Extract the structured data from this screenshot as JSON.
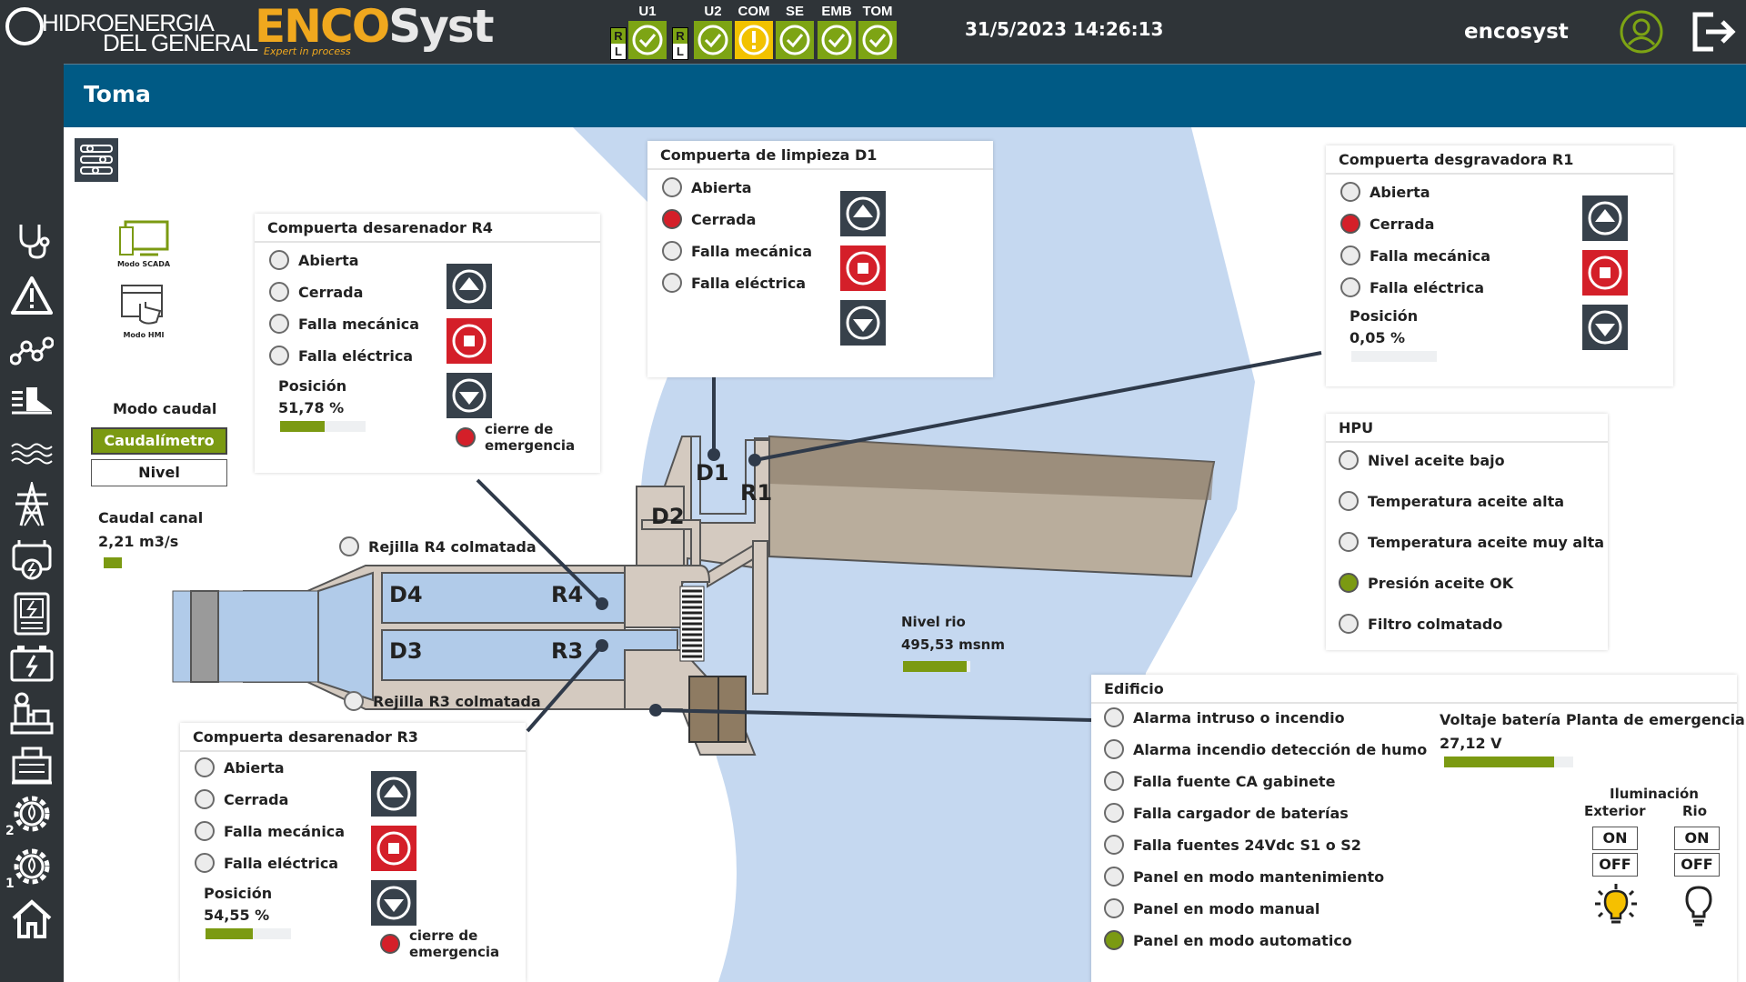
{
  "header": {
    "brand_line1": "HIDROENERGIA",
    "brand_line2": "DEL GENERAL",
    "logo_enco": "ENCO",
    "logo_syst": "Syst",
    "logo_tag": "Expert in process",
    "status": [
      {
        "label": "U1",
        "state": "ok",
        "rl": true
      },
      {
        "label": "U2",
        "state": "ok",
        "rl": true
      },
      {
        "label": "COM",
        "state": "warning",
        "rl": false
      },
      {
        "label": "SE",
        "state": "ok",
        "rl": false
      },
      {
        "label": "EMB",
        "state": "ok",
        "rl": false
      },
      {
        "label": "TOM",
        "state": "ok",
        "rl": false
      }
    ],
    "rl_r": "R",
    "rl_l": "L",
    "datetime": "31/5/2023 14:26:13",
    "username": "encosyst"
  },
  "page_title": "Toma",
  "mode_icons": {
    "scada_label": "Modo SCADA",
    "hmi_label": "Modo HMI"
  },
  "modo_caudal": {
    "title": "Modo caudal",
    "options": [
      "Caudalímetro",
      "Nivel"
    ],
    "active": "Caudalímetro"
  },
  "caudal_canal": {
    "label": "Caudal canal",
    "value": "2,21 m3/s"
  },
  "r4": {
    "title": "Compuerta desarenador R4",
    "states": [
      "Abierta",
      "Cerrada",
      "Falla mecánica",
      "Falla eléctrica"
    ],
    "active_state": "",
    "pos_label": "Posición",
    "pos_value": "51,78 %",
    "pos_fraction": 0.52,
    "emergency_label": "cierre de emergencia"
  },
  "r3": {
    "title": "Compuerta desarenador R3",
    "states": [
      "Abierta",
      "Cerrada",
      "Falla mecánica",
      "Falla eléctrica"
    ],
    "active_state": "",
    "pos_label": "Posición",
    "pos_value": "54,55 %",
    "pos_fraction": 0.55,
    "emergency_label": "cierre de emergencia"
  },
  "d1": {
    "title": "Compuerta de limpieza D1",
    "states": [
      "Abierta",
      "Cerrada",
      "Falla mecánica",
      "Falla eléctrica"
    ],
    "active_state": "Cerrada"
  },
  "r1": {
    "title": "Compuerta desgravadora R1",
    "states": [
      "Abierta",
      "Cerrada",
      "Falla mecánica",
      "Falla eléctrica"
    ],
    "active_state": "Cerrada",
    "pos_label": "Posición",
    "pos_value": "0,05 %",
    "pos_fraction": 0.0
  },
  "hpu": {
    "title": "HPU",
    "items": [
      {
        "label": "Nivel aceite bajo",
        "state": "off"
      },
      {
        "label": "Temperatura aceite alta",
        "state": "off"
      },
      {
        "label": "Temperatura aceite muy alta",
        "state": "off"
      },
      {
        "label": "Presión aceite OK",
        "state": "on"
      },
      {
        "label": "Filtro colmatado",
        "state": "off"
      }
    ]
  },
  "edificio": {
    "title": "Edificio",
    "items": [
      {
        "label": "Alarma intruso o incendio",
        "state": "off"
      },
      {
        "label": "Alarma incendio detección de humo",
        "state": "off"
      },
      {
        "label": "Falla fuente CA gabinete",
        "state": "off"
      },
      {
        "label": "Falla cargador de baterías",
        "state": "off"
      },
      {
        "label": "Falla fuentes 24Vdc S1 o S2",
        "state": "off"
      },
      {
        "label": "Panel en modo mantenimiento",
        "state": "off"
      },
      {
        "label": "Panel en modo manual",
        "state": "off"
      },
      {
        "label": "Panel en modo automatico",
        "state": "on"
      }
    ],
    "battery_label": "Voltaje batería Planta de emergencia",
    "battery_value": "27,12 V",
    "battery_fraction": 0.85,
    "ilum_title": "Iluminación",
    "ilum_exterior": "Exterior",
    "ilum_rio": "Rio",
    "on_label": "ON",
    "off_label": "OFF",
    "exterior_state": "on",
    "rio_state": "off"
  },
  "diagram": {
    "rejilla_r4": "Rejilla R4 colmatada",
    "rejilla_r3": "Rejilla R3 colmatada",
    "nivel_rio_label": "Nivel rio",
    "nivel_rio_value": "495,53 msnm",
    "nivel_rio_fraction": 0.95,
    "labels": {
      "d1": "D1",
      "r1": "R1",
      "d2": "D2",
      "d3": "D3",
      "d4": "D4",
      "r3": "R3",
      "r4": "R4"
    }
  },
  "sidebar_numbers": [
    "2",
    "1"
  ],
  "colors": {
    "dark_bg": "#2f3438",
    "title_bar": "#005a85",
    "ok_green": "#7da414",
    "warn_yellow": "#f2c200",
    "alarm_red": "#d41f29",
    "water_blue": "#c5d8f0",
    "channel_blue": "#b1cbe9"
  }
}
